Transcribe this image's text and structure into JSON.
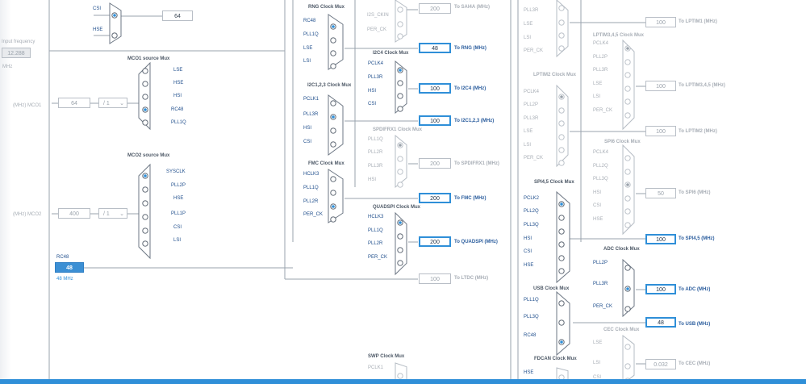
{
  "input_frequency": {
    "label": "Input frequency",
    "value": "12.288",
    "unit": "MHz"
  },
  "rc48": {
    "label": "RC48",
    "value": "48",
    "unit": "48 MHz"
  },
  "top": {
    "csi": "CSI",
    "hse": "HSE",
    "value": "64"
  },
  "mco1": {
    "title": "MCO1 source Mux",
    "inputs": [
      "LSE",
      "HSE",
      "HSI",
      "RC48",
      "PLL1Q"
    ],
    "pin": "(MHz) MCO1",
    "value": "64",
    "divider": "/ 1"
  },
  "mco2": {
    "title": "MCO2 source Mux",
    "inputs": [
      "SYSCLK",
      "PLL2P",
      "HSE",
      "PLL1P",
      "CSI",
      "LSI"
    ],
    "pin": "(MHz) MCO2",
    "value": "400",
    "divider": "/ 1"
  },
  "rng": {
    "title": "RNG Clock Mux",
    "inputs": [
      "RC48",
      "PLL1Q",
      "LSE",
      "LSI"
    ],
    "value": "48",
    "label": "To RNG (MHz)"
  },
  "sai": {
    "inputs": [
      "I2S_CKIN",
      "PER_CK"
    ],
    "value": "200",
    "label": "To SAI4A (MHz)"
  },
  "i2c4": {
    "title": "I2C4 Clock Mux",
    "inputs": [
      "PCLK4",
      "PLL3R",
      "HSI",
      "CSI"
    ],
    "value": "100",
    "label": "To I2C4 (MHz)"
  },
  "i2c123": {
    "title": "I2C1,2,3 Clock Mux",
    "inputs": [
      "PCLK1",
      "PLL3R",
      "HSI",
      "CSI"
    ],
    "value": "100",
    "label": "To I2C1,2,3 (MHz)"
  },
  "spdif": {
    "title": "SPDIFRX1 Clock Mux",
    "inputs": [
      "PLL1Q",
      "PLL2R",
      "PLL3R",
      "HSI"
    ],
    "value": "200",
    "label": "To SPDIFRX1 (MHz)"
  },
  "fmc": {
    "title": "FMC Clock Mux",
    "inputs": [
      "HCLK3",
      "PLL1Q",
      "PLL2R",
      "PER_CK"
    ],
    "value": "200",
    "label": "To FMC (MHz)"
  },
  "qspi": {
    "title": "QUADSPI Clock Mux",
    "inputs": [
      "HCLK3",
      "PLL1Q",
      "PLL2R",
      "PER_CK"
    ],
    "value": "200",
    "label": "To QUADSPI (MHz)"
  },
  "ltdc": {
    "value": "100",
    "label": "To LTDC (MHz)"
  },
  "swp": {
    "title": "SWP Clock Mux",
    "inputs": [
      "PCLK1"
    ]
  },
  "lptim1": {
    "inputs": [
      "PLL3R",
      "LSE",
      "LSI",
      "PER_CK"
    ],
    "value": "100",
    "label": "To LPTIM1 (MHz)"
  },
  "lptim345": {
    "title": "LPTIM3,4,5 Clock Mux",
    "inputs": [
      "PCLK4",
      "PLL2P",
      "PLL3R",
      "LSE",
      "LSI",
      "PER_CK"
    ],
    "value": "100",
    "label": "To LPTIM3,4,5 (MHz)"
  },
  "lptim2": {
    "title": "LPTIM2 Clock Mux",
    "inputs": [
      "PCLK4",
      "PLL2P",
      "PLL3R",
      "LSE",
      "LSI",
      "PER_CK"
    ],
    "value": "100",
    "label": "To LPTIM2 (MHz)"
  },
  "spi6": {
    "title": "SPI6 Clock Mux",
    "inputs": [
      "PCLK4",
      "PLL2Q",
      "PLL3Q",
      "HSI",
      "CSI",
      "HSE"
    ],
    "value": "50",
    "label": "To SPI6 (MHz)"
  },
  "spi45": {
    "title": "SPI4,5 Clock Mux",
    "inputs": [
      "PCLK2",
      "PLL2Q",
      "PLL3Q",
      "HSI",
      "CSI",
      "HSE"
    ],
    "value": "100",
    "label": "To SPI4,5 (MHz)"
  },
  "adc": {
    "title": "ADC Clock Mux",
    "inputs": [
      "PLL2P",
      "PLL3R",
      "PER_CK"
    ],
    "value": "100",
    "label": "To ADC (MHz)"
  },
  "usb": {
    "title": "USB Clock Mux",
    "inputs": [
      "PLL1Q",
      "PLL3Q",
      "RC48"
    ],
    "value": "48",
    "label": "To USB (MHz)"
  },
  "cec": {
    "title": "CEC Clock Mux",
    "inputs": [
      "LSE",
      "LSI",
      "CSI"
    ],
    "value": "0.032",
    "label": "To CEC (MHz)"
  },
  "fdcan": {
    "title": "FDCAN Clock Mux",
    "inputs": [
      "HSE"
    ]
  }
}
